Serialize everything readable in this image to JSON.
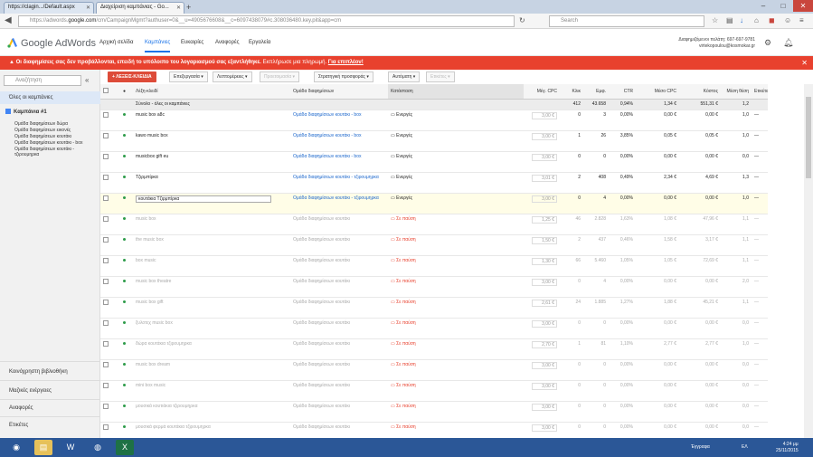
{
  "browser": {
    "tabs": [
      {
        "label": "https://clagin.../Default.aspx"
      },
      {
        "label": "Διαχείριση καμπάνιας - Go..."
      }
    ],
    "url_prefix": "https://adwords.",
    "url_domain": "google.com",
    "url_rest": "/cm/CampaignMgmt?authuser=0&__u=4905676608&__c=6097438079#c.308036480.key.pit&app=cm",
    "search_placeholder": "Search"
  },
  "header": {
    "logo": "Google AdWords",
    "nav": [
      "Αρχική σελίδα",
      "Καμπάνιες",
      "Ευκαιρίες",
      "Αναφορές",
      "Εργαλεία"
    ],
    "account_line1": "Διαφημιζόμενοι πελάτη: 697-697-9781",
    "account_line2": "virtekopoulou@kosmokar.gr"
  },
  "alert": {
    "text": "Οι διαφημίσεις σας δεν προβάλλονται, επειδή το υπόλοιπο του λογαριασμού σας εξαντλήθηκε.",
    "hint": "Εκπλήρωσε μια πληρωμή.",
    "link": "Για επιπλέον!"
  },
  "sidebar": {
    "search_placeholder": "Αναζήτηση",
    "all_campaigns": "Όλες οι καμπάνιες",
    "campaign": "Καμπάνια #1",
    "ad_groups": [
      "Ομάδα διαφημίσεων δώρα",
      "Ομάδα διαφημίσεων εικονές",
      "Ομάδα διαφημίσεων κουτάκι",
      "Ομάδα διαφημίσεων κουτάκι - box",
      "Ομάδα διαφημίσεων κουτάκι - τζιρουμηρκα"
    ],
    "bottom": [
      "Κοινόχρηστη βιβλιοθήκη",
      "Μαζικές ενέργειες",
      "Αναφορές",
      "Ετικέτες"
    ]
  },
  "toolbar": {
    "add": "+ ΛΕΞΕΙΣ-ΚΛΕΙΔΙΑ",
    "buttons": [
      "Επεξεργασία ▾",
      "Λεπτομέρειες ▾",
      "Προετοιμασία ▾",
      "Στρατηγική προσφοράς ▾",
      "Αυτόματη ▾",
      "Ετικέτες ▾"
    ]
  },
  "table": {
    "headers": [
      "",
      "●",
      "Λέξη-κλειδί",
      "Ομάδα διαφημίσεων",
      "Κατάσταση",
      "Μέγ. CPC",
      "Κλικ",
      "Εμφ.",
      "CTR",
      "Μέσο CPC",
      "Κόστος",
      "Μέση θέση",
      "Ετικέτες"
    ],
    "total": {
      "label": "Σύνολο - όλες οι καμπάνιες",
      "clicks": "412",
      "impr": "43.658",
      "ctr": "0,94%",
      "avg_cpc": "1,34 €",
      "cost": "551,31 €",
      "pos": "1,2"
    },
    "rows": [
      {
        "kw": "music box a8c",
        "ag": "Ομάδα διαφημίσεων κουτάκι - box",
        "status": "Ενεργές",
        "bid": "3,00 €",
        "clicks": "0",
        "impr": "3",
        "ctr": "0,00%",
        "avg_cpc": "0,00 €",
        "cost": "0,00 €",
        "pos": "1,0",
        "labels": "—"
      },
      {
        "kw": "kawo music box",
        "ag": "Ομάδα διαφημίσεων κουτάκι - box",
        "status": "Ενεργές",
        "bid": "3,00 €",
        "clicks": "1",
        "impr": "26",
        "ctr": "3,85%",
        "avg_cpc": "0,05 €",
        "cost": "0,05 €",
        "pos": "1,0",
        "labels": "—"
      },
      {
        "kw": "musicbox gift eu",
        "ag": "Ομάδα διαφημίσεων κουτάκι - box",
        "status": "Ενεργές",
        "bid": "3,00 €",
        "clicks": "0",
        "impr": "0",
        "ctr": "0,00%",
        "avg_cpc": "0,00 €",
        "cost": "0,00 €",
        "pos": "0,0",
        "labels": "—"
      },
      {
        "kw": "Τζιρμπίρκα",
        "ag": "Ομάδα διαφημίσεων κουτάκι - τζιρουμηρκα",
        "status": "Ενεργές",
        "bid": "3,01 €",
        "clicks": "2",
        "impr": "408",
        "ctr": "0,49%",
        "avg_cpc": "2,34 €",
        "cost": "4,69 €",
        "pos": "1,3",
        "labels": "—"
      },
      {
        "kw": "κουτάκια Τζιρμπίρκα",
        "ag": "Ομάδα διαφημίσεων κουτάκι - τζιρουμηρκα",
        "status": "Ενεργές",
        "bid": "3,00 €",
        "clicks": "0",
        "impr": "4",
        "ctr": "0,00%",
        "avg_cpc": "0,00 €",
        "cost": "0,00 €",
        "pos": "1,0",
        "labels": "—"
      },
      {
        "kw": "music box",
        "ag": "Ομάδα διαφημίσεων κουτάκι",
        "status": "Σε παύση",
        "bid": "1,25 €",
        "clicks": "46",
        "impr": "2.828",
        "ctr": "1,63%",
        "avg_cpc": "1,08 €",
        "cost": "47,96 €",
        "pos": "1,1",
        "labels": "—"
      },
      {
        "kw": "the music box",
        "ag": "Ομάδα διαφημίσεων κουτάκι",
        "status": "Σε παύση",
        "bid": "1,50 €",
        "clicks": "2",
        "impr": "437",
        "ctr": "0,46%",
        "avg_cpc": "1,58 €",
        "cost": "3,17 €",
        "pos": "1,1",
        "labels": "—"
      },
      {
        "kw": "box music",
        "ag": "Ομάδα διαφημίσεων κουτάκι",
        "status": "Σε παύση",
        "bid": "1,30 €",
        "clicks": "66",
        "impr": "5.460",
        "ctr": "1,05%",
        "avg_cpc": "1,05 €",
        "cost": "72,69 €",
        "pos": "1,1",
        "labels": "—"
      },
      {
        "kw": "music box theatre",
        "ag": "Ομάδα διαφημίσεων κουτάκι",
        "status": "Σε παύση",
        "bid": "3,00 €",
        "clicks": "0",
        "impr": "4",
        "ctr": "0,00%",
        "avg_cpc": "0,00 €",
        "cost": "0,00 €",
        "pos": "2,0",
        "labels": "—"
      },
      {
        "kw": "music box gift",
        "ag": "Ομάδα διαφημίσεων κουτάκι",
        "status": "Σε παύση",
        "bid": "2,61 €",
        "clicks": "24",
        "impr": "1.885",
        "ctr": "1,27%",
        "avg_cpc": "1,88 €",
        "cost": "45,21 €",
        "pos": "1,1",
        "labels": "—"
      },
      {
        "kw": "ξυλοτεχ music box",
        "ag": "Ομάδα διαφημίσεων κουτάκι",
        "status": "Σε παύση",
        "bid": "3,00 €",
        "clicks": "0",
        "impr": "0",
        "ctr": "0,00%",
        "avg_cpc": "0,00 €",
        "cost": "0,00 €",
        "pos": "0,0",
        "labels": "—"
      },
      {
        "kw": "δώρα κουτάκια τζιρουμηρκα",
        "ag": "Ομάδα διαφημίσεων κουτάκι",
        "status": "Σε παύση",
        "bid": "2,70 €",
        "clicks": "1",
        "impr": "81",
        "ctr": "1,10%",
        "avg_cpc": "2,77 €",
        "cost": "2,77 €",
        "pos": "1,0",
        "labels": "—"
      },
      {
        "kw": "music box dream",
        "ag": "Ομάδα διαφημίσεων κουτάκι",
        "status": "Σε παύση",
        "bid": "3,00 €",
        "clicks": "0",
        "impr": "0",
        "ctr": "0,00%",
        "avg_cpc": "0,00 €",
        "cost": "0,00 €",
        "pos": "0,0",
        "labels": "—"
      },
      {
        "kw": "mini box music",
        "ag": "Ομάδα διαφημίσεων κουτάκι",
        "status": "Σε παύση",
        "bid": "3,00 €",
        "clicks": "0",
        "impr": "0",
        "ctr": "0,00%",
        "avg_cpc": "0,00 €",
        "cost": "0,00 €",
        "pos": "0,0",
        "labels": "—"
      },
      {
        "kw": "μουσικά κουτιάκια τζιρουμηρκα",
        "ag": "Ομάδα διαφημίσεων κουτάκι",
        "status": "Σε παύση",
        "bid": "3,00 €",
        "clicks": "0",
        "impr": "0",
        "ctr": "0,00%",
        "avg_cpc": "0,00 €",
        "cost": "0,00 €",
        "pos": "0,0",
        "labels": "—"
      },
      {
        "kw": "μουσικά φερμά κουτάκια τζιρουμηρκα",
        "ag": "Ομάδα διαφημίσεων κουτάκι",
        "status": "Σε παύση",
        "bid": "3,00 €",
        "clicks": "0",
        "impr": "0",
        "ctr": "0,00%",
        "avg_cpc": "0,00 €",
        "cost": "0,00 €",
        "pos": "0,0",
        "labels": "—"
      }
    ]
  },
  "taskbar": {
    "lang": "Έγγραφα",
    "lang2": "ΕΛ",
    "time": "4:24 μμ",
    "date": "25/11/2015"
  }
}
